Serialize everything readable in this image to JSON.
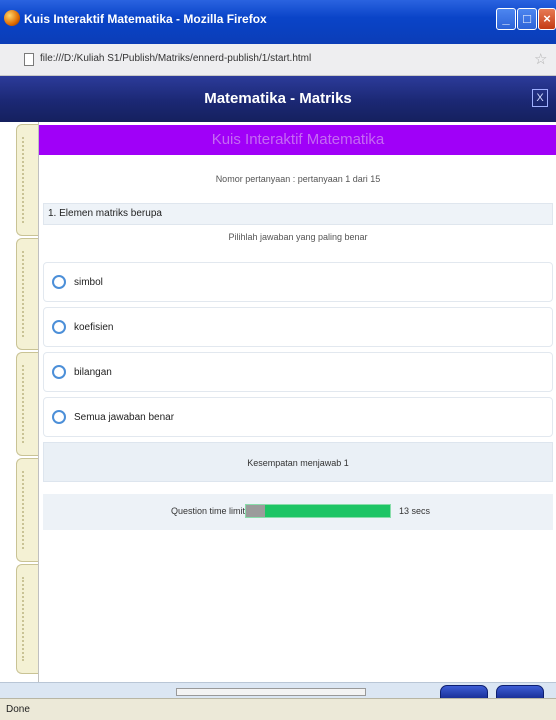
{
  "window": {
    "title": "Kuis Interaktif Matematika - Mozilla Firefox",
    "minimize": "_",
    "maximize": "□",
    "close": "×"
  },
  "address_bar": {
    "url": "file:///D:/Kuliah S1/Publish/Matriks/ennerd-publish/1/start.html"
  },
  "quiz": {
    "header_title": "Matematika - Matriks",
    "close_label": "X",
    "banner_title": "Kuis Interaktif Matematika",
    "question_counter": "Nomor pertanyaan : pertanyaan 1 dari 15",
    "question_text": "1. Elemen matriks berupa",
    "instruction": "Pilihlah jawaban yang paling benar",
    "options": [
      {
        "label": "simbol"
      },
      {
        "label": "koefisien"
      },
      {
        "label": "bilangan"
      },
      {
        "label": "Semua jawaban benar"
      }
    ],
    "attempts_text": "Kesempatan menjawab 1",
    "timer": {
      "label": "Question time limit",
      "elapsed_fraction": 0.13,
      "value": "13 secs"
    }
  },
  "status_bar": {
    "text": "Done"
  },
  "colors": {
    "titlebar": "#0a44c8",
    "quiz_header": "#1b2874",
    "banner": "#a000f8",
    "timer_bar": "#1dc565",
    "side_tabs": "#f4f1d4"
  }
}
